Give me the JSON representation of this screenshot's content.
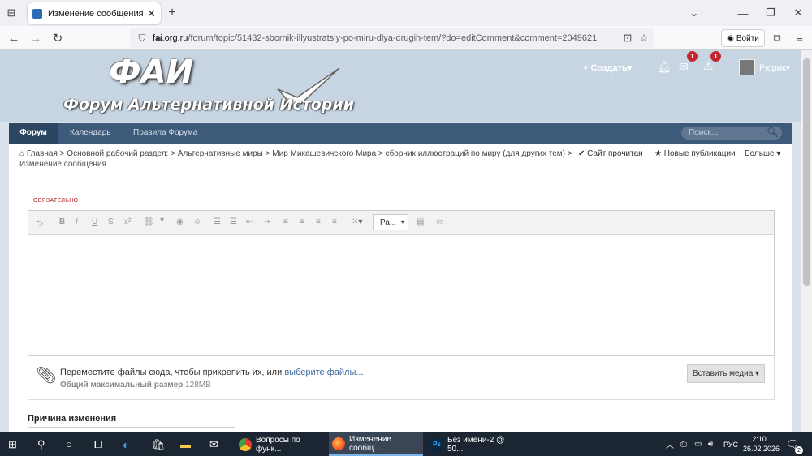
{
  "browser": {
    "tab_title": "Изменение сообщения - сбор",
    "url_domain": "fai.org.ru",
    "url_path": "/forum/topic/51432-sbornik-illyustratsiy-po-miru-dlya-drugih-tem/?do=editComment&comment=2049621",
    "signin_label": "Войти"
  },
  "site": {
    "logo_title": "ФАИ",
    "logo_subtitle": "Форум Альтернативной Истории",
    "create_label": "Создать",
    "messages_badge": "1",
    "alerts_badge": "1",
    "user_name": "Рюрик"
  },
  "menu": {
    "items": [
      "Форум",
      "Календарь",
      "Правила Форума"
    ],
    "search_placeholder": "Поиск..."
  },
  "breadcrumb": {
    "items": [
      "Главная",
      "Основной рабочий раздел:",
      "Альтернативные миры",
      "Мир Микашевичского Мира",
      "сборник иллюстраций по миру (для других тем)"
    ],
    "current": "Изменение сообщения",
    "mark_read": "Сайт прочитан",
    "new_posts": "Новые публикации",
    "more": "Больше"
  },
  "editor": {
    "required_label": "ОБЯЗАТЕЛЬНО",
    "paragraph_select": "Ра...",
    "attach_text": "Переместите файлы сюда, чтобы прикрепить их, или",
    "attach_link": "выберите файлы...",
    "max_size_label": "Общий максимальный размер",
    "max_size_value": "128MB",
    "insert_media": "Вставить медиа"
  },
  "reason": {
    "label": "Причина изменения"
  },
  "taskbar": {
    "apps": [
      "Вопросы по функ...",
      "Изменение сообщ...",
      "Без имени-2 @ 50..."
    ],
    "lang": "РУС",
    "time": "2:10",
    "date": "26.02.2026",
    "notification_count": "2"
  },
  "colors": {
    "header_bg": "#c7d5e3",
    "menu_bg": "#3d5a7a",
    "badge": "#c4262e",
    "link": "#3b6a99",
    "required": "#b52020"
  }
}
